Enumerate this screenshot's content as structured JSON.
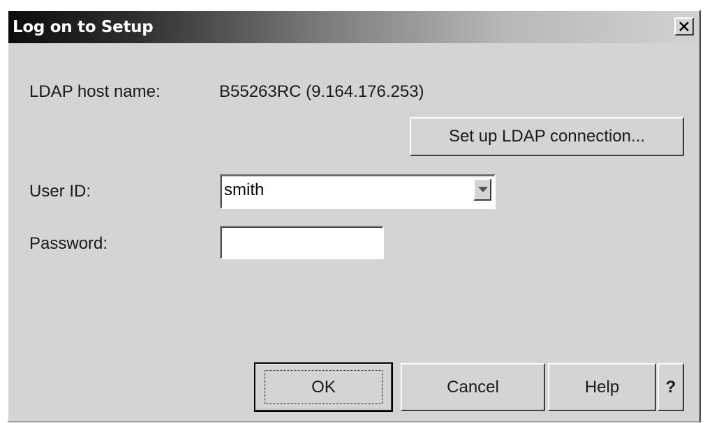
{
  "window": {
    "title": "Log on to Setup",
    "close_icon": "close-icon"
  },
  "ldap": {
    "host_label": "LDAP host name:",
    "host_value": "B55263RC (9.164.176.253)",
    "setup_button": "Set up LDAP connection..."
  },
  "user": {
    "label": "User ID:",
    "value": "smith",
    "dropdown_icon": "chevron-down-icon"
  },
  "password": {
    "label": "Password:",
    "value": ""
  },
  "buttons": {
    "ok": "OK",
    "cancel": "Cancel",
    "help": "Help",
    "context_help": "?"
  },
  "colors": {
    "dialog_bg": "#d4d4d4",
    "title_text": "#ffffff",
    "field_bg": "#ffffff"
  }
}
